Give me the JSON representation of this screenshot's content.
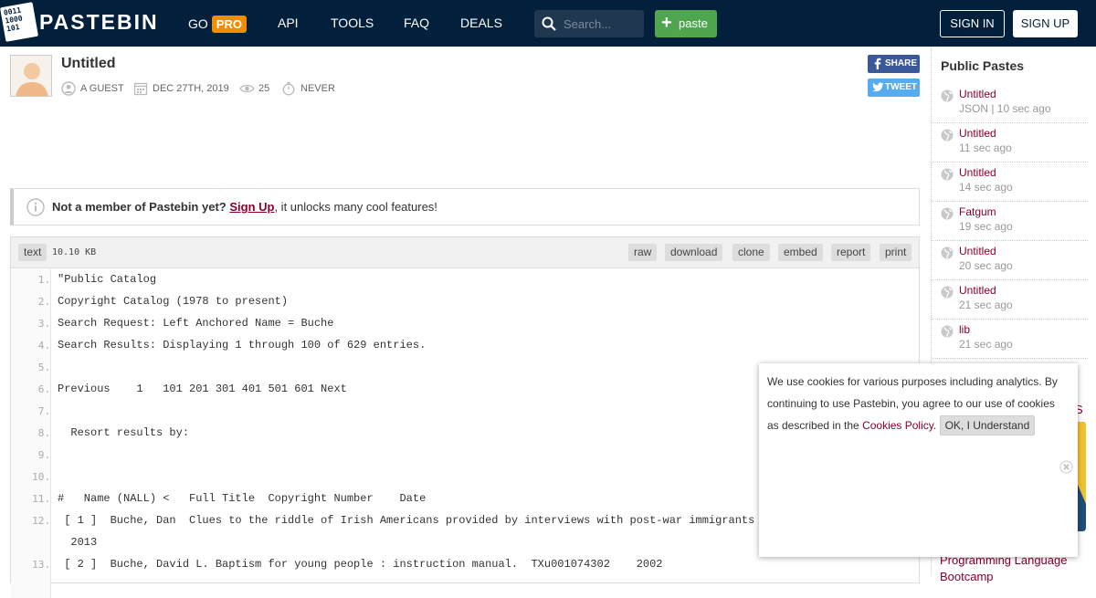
{
  "header": {
    "logo_text": "PASTEBIN",
    "logo_bits": "0011\n1000\n101",
    "nav": {
      "go": "GO",
      "pro": "PRO",
      "api": "API",
      "tools": "TOOLS",
      "faq": "FAQ",
      "deals": "DEALS"
    },
    "search_placeholder": "Search...",
    "paste_label": "paste",
    "sign_in": "SIGN IN",
    "sign_up": "SIGN UP"
  },
  "paste": {
    "title": "Untitled",
    "author": "A GUEST",
    "date": "DEC 27TH, 2019",
    "views": "25",
    "expiry": "NEVER",
    "share": "SHARE",
    "tweet": "TWEET"
  },
  "notice": {
    "lead": "Not a member of Pastebin yet?",
    "link": "Sign Up",
    "rest": ", it unlocks many cool features!"
  },
  "code_toolbar": {
    "syntax": "text",
    "size": "10.10 KB",
    "actions": [
      "raw",
      "download",
      "clone",
      "embed",
      "report",
      "print"
    ]
  },
  "code": [
    {
      "n": "1.",
      "text": "\"Public Catalog"
    },
    {
      "n": "2.",
      "text": "Copyright Catalog (1978 to present)"
    },
    {
      "n": "3.",
      "text": "Search Request: Left Anchored Name = Buche"
    },
    {
      "n": "4.",
      "text": "Search Results: Displaying 1 through 100 of 629 entries."
    },
    {
      "n": "5.",
      "text": ""
    },
    {
      "n": "6.",
      "text": "Previous    1   101 201 301 401 501 601 Next"
    },
    {
      "n": "7.",
      "text": ""
    },
    {
      "n": "8.",
      "text": "  Resort results by:"
    },
    {
      "n": "9.",
      "text": ""
    },
    {
      "n": "10.",
      "text": ""
    },
    {
      "n": "11.",
      "text": "#   Name (NALL) <   Full Title  Copyright Number    Date"
    },
    {
      "n": "12.",
      "text": " [ 1 ]  Buche, Dan  Clues to the riddle of Irish Americans provided by interviews with post-war immigrants to"
    },
    {
      "n": "",
      "text": "  2013"
    },
    {
      "n": "13.",
      "text": " [ 2 ]  Buche, David L. Baptism for young people : instruction manual.  TXu001074302    2002"
    }
  ],
  "sidebar": {
    "title": "Public Pastes",
    "items": [
      {
        "name": "Untitled",
        "sub": "JSON | 10 sec ago"
      },
      {
        "name": "Untitled",
        "sub": "11 sec ago"
      },
      {
        "name": "Untitled",
        "sub": "14 sec ago"
      },
      {
        "name": "Fatgum",
        "sub": "19 sec ago"
      },
      {
        "name": "Untitled",
        "sub": "20 sec ago"
      },
      {
        "name": "Untitled",
        "sub": "21 sec ago"
      },
      {
        "name": "lib",
        "sub": "21 sec ago"
      }
    ],
    "partial_link_s": "S",
    "link1": "Programming Language",
    "link2": "Bootcamp"
  },
  "cookie": {
    "text": "We use cookies for various purposes including analytics. By continuing to use Pastebin, you agree to our use of cookies as described in the ",
    "policy_link": "Cookies Policy",
    "after_link": ".",
    "ok_label": "OK, I Understand"
  },
  "colors": {
    "header_bg": "#02203c",
    "pro_orange": "#f28c00",
    "paste_green": "#4fa64f",
    "link_red": "#8b0029",
    "facebook": "#3b5998",
    "twitter": "#55acee"
  }
}
